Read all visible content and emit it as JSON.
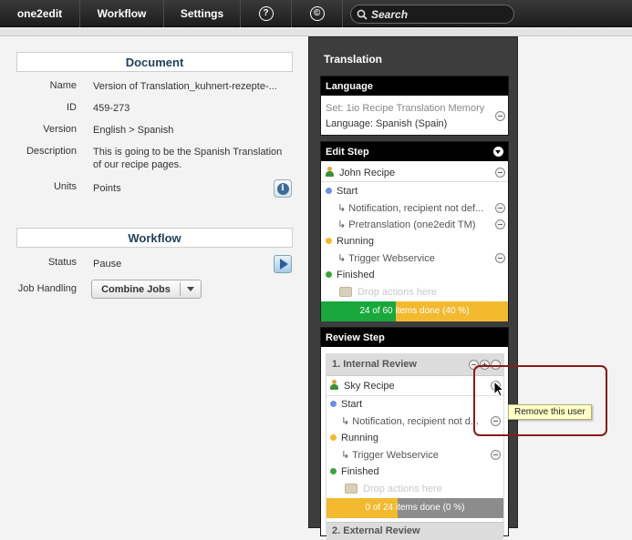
{
  "toolbar": {
    "brand": "one2edit",
    "workflow": "Workflow",
    "settings": "Settings",
    "help_icon": "?",
    "copyright_icon": "©",
    "search_placeholder": "Search"
  },
  "document": {
    "title": "Document",
    "fields": {
      "name_label": "Name",
      "name_value": "Version of Translation_kuhnert-rezepte-...",
      "id_label": "ID",
      "id_value": "459-273",
      "version_label": "Version",
      "version_value": "English > Spanish",
      "description_label": "Description",
      "description_line1": "This is going to be the Spanish Translation",
      "description_line2": "of our recipe pages.",
      "units_label": "Units",
      "units_value": "Points"
    }
  },
  "workflow": {
    "title": "Workflow",
    "status_label": "Status",
    "status_value": "Pause",
    "job_handling_label": "Job Handling",
    "job_handling_value": "Combine Jobs"
  },
  "translation": {
    "title": "Translation",
    "language": {
      "header": "Language",
      "set": "Set: 1io Recipe Translation Memory",
      "language": "Language: Spanish (Spain)"
    },
    "edit_step": {
      "header": "Edit Step",
      "user": "John Recipe",
      "start": "Start",
      "notification": "Notification, recipient not def...",
      "pretranslation": "Pretranslation (one2edit TM)",
      "running": "Running",
      "trigger": "Trigger Webservice",
      "finished": "Finished",
      "drop": "Drop actions here",
      "progress_text": "24 of 60 items done (40 %)",
      "progress_fraction": 0.4
    },
    "review_step": {
      "header": "Review Step",
      "internal_review": "1. Internal Review",
      "user": "Sky Recipe",
      "start": "Start",
      "notification": "Notification, recipient not d...",
      "running": "Running",
      "trigger": "Trigger Webservice",
      "finished": "Finished",
      "drop": "Drop actions here",
      "progress_text": "0 of 24 items done (0 %)",
      "progress_fraction": 0.0,
      "external_review": "2. External Review"
    }
  },
  "tooltip": "Remove this user",
  "colors": {
    "progress_green": "#18a83b",
    "progress_yellow": "#f3b92f",
    "progress_gray": "#8c8c8c",
    "highlight": "#8b1a1a",
    "dot_blue": "#6b8ee8",
    "dot_orange": "#f3b92f",
    "dot_green": "#3aa53a"
  }
}
